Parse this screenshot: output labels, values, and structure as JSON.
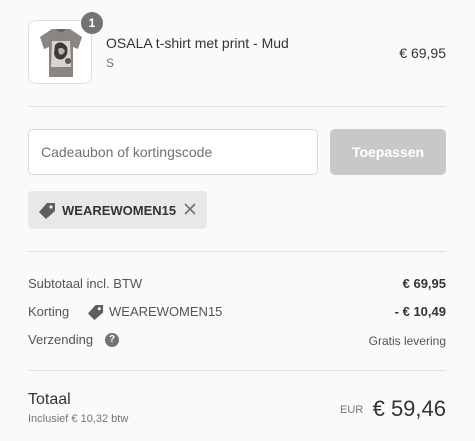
{
  "product": {
    "quantity": "1",
    "name": "OSALA t-shirt met print - Mud",
    "variant": "S",
    "price": "€ 69,95"
  },
  "discount_form": {
    "placeholder": "Cadeaubon of kortingscode",
    "apply_label": "Toepassen",
    "applied_code": "WEAREWOMEN15"
  },
  "summary": {
    "subtotal_label": "Subtotaal incl. BTW",
    "subtotal_value": "€ 69,95",
    "discount_label": "Korting",
    "discount_code": "WEAREWOMEN15",
    "discount_value": "- € 10,49",
    "shipping_label": "Verzending",
    "shipping_value": "Gratis levering"
  },
  "total": {
    "label": "Totaal",
    "tax_note": "Inclusief € 10,32 btw",
    "currency": "EUR",
    "amount": "€ 59,46"
  },
  "colors": {
    "badge": "#737373",
    "button_disabled": "#c8c8c8",
    "tag_background": "#e8e8e8"
  }
}
